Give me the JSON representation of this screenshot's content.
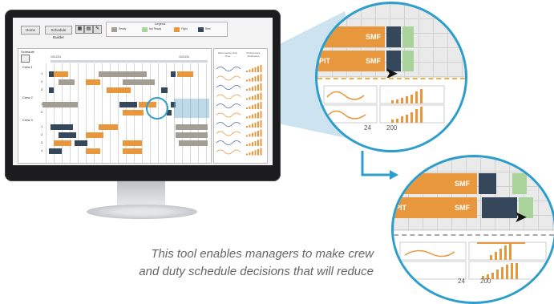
{
  "toolbar": {
    "home_label": "Home",
    "schedule_builder_label": "Schedule Builder"
  },
  "legend": {
    "title": "Legend",
    "items": [
      "Ready",
      "Not Ready",
      "Flight",
      "Rest"
    ]
  },
  "schedule": {
    "title": "Schedule",
    "crews": [
      "Crew 1",
      "Crew 2",
      "Crew 3"
    ],
    "dates": [
      "10/12/11",
      "10/13/11"
    ]
  },
  "performance": {
    "col1": "Performance Over Time",
    "col2": "Performance Distribution"
  },
  "zoom": {
    "bar_label_top": "SMF",
    "bar_label_origin": "PIT",
    "bar_label_dest": "SMF",
    "axis_ticks": [
      "24",
      "200",
      "28"
    ]
  },
  "caption": {
    "line1": "This tool enables managers to make crew",
    "line2": "and duty schedule decisions that will reduce"
  },
  "colors": {
    "accent": "#2d9ecb",
    "flight": "#e8973d",
    "rest": "#35475a",
    "ready": "#a39e93",
    "not_ready": "#a8d39a"
  }
}
